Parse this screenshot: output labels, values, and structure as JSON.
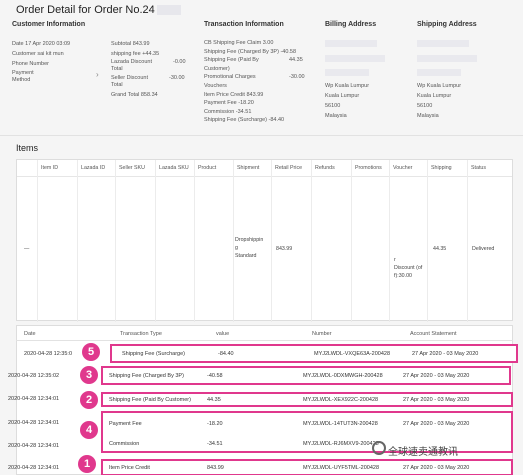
{
  "header": {
    "title": "Order Detail for Order No.24"
  },
  "customer": {
    "heading": "Customer Information",
    "date_label": "Date",
    "date_value": "17 Apr 2020 03:09",
    "customer_label": "Customer",
    "customer_value": "sai kit mun",
    "phone_label": "Phone Number",
    "payment_label_1": "Payment",
    "payment_label_2": "Method"
  },
  "summary": {
    "subtotal_label": "Subtotal",
    "subtotal_value": "843.99",
    "shipping_label": "shipping fee",
    "shipping_value": "+44.35",
    "lazada_discount_label_1": "Lazada Discount",
    "lazada_discount_label_2": "Total",
    "lazada_discount_value": "-0.00",
    "seller_discount_label_1": "Seller Discount",
    "seller_discount_label_2": "Total",
    "seller_discount_value": "-30.00",
    "grand_total_label": "Grand Total",
    "grand_total_value": "858.34"
  },
  "transaction": {
    "heading": "Transaction Information",
    "rows": [
      {
        "label": "CB Shipping Fee Claim",
        "value": "3.00"
      },
      {
        "label": "Shipping Fee (Charged By 3P)",
        "value": "-40.58"
      },
      {
        "label": "Shipping Fee (Paid By",
        "value": "44.35"
      },
      {
        "label": "Customer)",
        "value": ""
      },
      {
        "label": "Promotional Charges",
        "value": "-30.00"
      },
      {
        "label": "Vouchers",
        "value": ""
      },
      {
        "label": "Item Price Credit",
        "value": "843.99"
      },
      {
        "label": "Payment Fee",
        "value": "-18.20"
      },
      {
        "label": "Commission",
        "value": "-34.51"
      },
      {
        "label": "Shipping Fee (Surcharge)",
        "value": "-84.40"
      }
    ]
  },
  "billing": {
    "heading": "Billing Address",
    "line1": "Wp Kuala Lumpur",
    "line2": "Kuala Lumpur",
    "line3": "56100",
    "line4": "Malaysia"
  },
  "shipping": {
    "heading": "Shipping Address",
    "line1": "Wp Kuala Lumpur",
    "line2": "Kuala Lumpur",
    "line3": "56100",
    "line4": "Malaysia"
  },
  "items": {
    "title": "Items",
    "columns": [
      "Item ID",
      "Lazada ID",
      "Seller SKU",
      "Lazada SKU",
      "Product",
      "Shipment",
      "Retail Price",
      "Refunds",
      "Promotions",
      "Voucher",
      "Shipping",
      "Status"
    ],
    "row": {
      "dash": "—",
      "shipment_1": "Dropshippin",
      "shipment_2": "g",
      "shipment_3": "Standard",
      "retail_price": "843.99",
      "voucher_1": "r",
      "voucher_2": "Discount (of",
      "voucher_3": "f):30.00",
      "shipping": "44.35",
      "status": "Delivered"
    }
  },
  "trans_table": {
    "headers": {
      "date": "Date",
      "type": "Transaction Type",
      "value": "value",
      "number": "Number",
      "statement": "Account Statement"
    },
    "rows": [
      {
        "badge": "5",
        "date": "2020-04-28 12:35:0",
        "type": "Shipping Fee (Surcharge)",
        "value": "-84.40",
        "number": "MYJ2LWDL-VXQE63A-200428",
        "statement": "27 Apr 2020 - 03 May 2020"
      },
      {
        "badge": "3",
        "date": "2020-04-28 12:35:02",
        "type": "Shipping Fee (Charged By 3P)",
        "value": "-40.58",
        "number": "MYJ2LWDL-0DXMWGH-200428",
        "statement": "27 Apr 2020 - 03 May 2020"
      },
      {
        "badge": "2",
        "date": "2020-04-28 12:34:01",
        "type": "Shipping Fee (Paid By Customer)",
        "value": "44.35",
        "number": "MYJ2LWDL-XEX922C-200428",
        "statement": "27 Apr 2020 - 03 May 2020"
      },
      {
        "badge": "4",
        "date": "2020-04-28 12:34:01",
        "type": "Payment Fee",
        "value": "-18.20",
        "number": "MYJ2LWDL-14TUT3N-200428",
        "statement": "27 Apr 2020 - 03 May 2020"
      },
      {
        "badge": "",
        "date": "2020-04-28 12:34:01",
        "type": "Commission",
        "value": "-34.51",
        "number": "MYJ2LWDL-RJ6MXV9-200428",
        "statement": "27 Apr 2020 - 03 May 2020"
      },
      {
        "badge": "1",
        "date": "2020-04-28 12:34:01",
        "type": "Item Price Credit",
        "value": "843.99",
        "number": "MYJ2LWDL-UYF5TML-200428",
        "statement": "27 Apr 2020 - 03 May 2020"
      }
    ]
  },
  "watermark": {
    "text": "全球速卖通教讯"
  },
  "colors": {
    "highlight": "#e0388d",
    "background": "#f5f5f5"
  }
}
